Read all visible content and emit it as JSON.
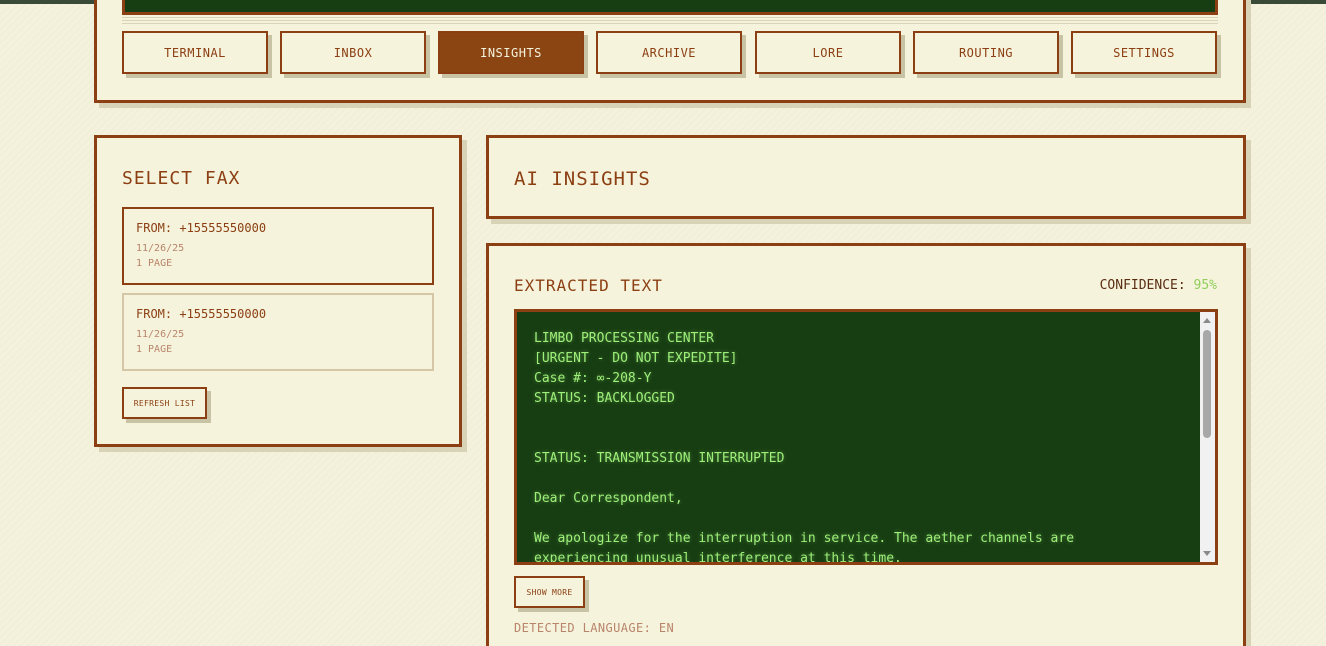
{
  "nav": {
    "tabs": [
      {
        "label": "TERMINAL"
      },
      {
        "label": "INBOX"
      },
      {
        "label": "INSIGHTS",
        "active": true
      },
      {
        "label": "ARCHIVE"
      },
      {
        "label": "LORE"
      },
      {
        "label": "ROUTING"
      },
      {
        "label": "SETTINGS"
      }
    ]
  },
  "select_fax": {
    "title": "SELECT FAX",
    "items": [
      {
        "from": "FROM: +15555550000",
        "date": "11/26/25",
        "pages": "1 PAGE"
      },
      {
        "from": "FROM: +15555550000",
        "date": "11/26/25",
        "pages": "1 PAGE"
      }
    ],
    "refresh_label": "REFRESH LIST"
  },
  "ai_insights": {
    "title": "AI INSIGHTS"
  },
  "extracted": {
    "title": "EXTRACTED TEXT",
    "confidence_label": "CONFIDENCE:",
    "confidence_value": "95%",
    "text": "LIMBO PROCESSING CENTER\n[URGENT - DO NOT EXPEDITE]\nCase #: ∞-208-Y\nSTATUS: BACKLOGGED\n\n\nSTATUS: TRANSMISSION INTERRUPTED\n\nDear Correspondent,\n\nWe apologize for the interruption in service. The aether channels are\nexperiencing unusual interference at this time.",
    "show_more_label": "SHOW MORE",
    "detected_language": "DETECTED LANGUAGE: EN"
  },
  "colors": {
    "accent": "#8b3f12",
    "terminal_bg": "#173d12",
    "terminal_text": "#9ef07a",
    "confidence": "#8fce5a"
  }
}
